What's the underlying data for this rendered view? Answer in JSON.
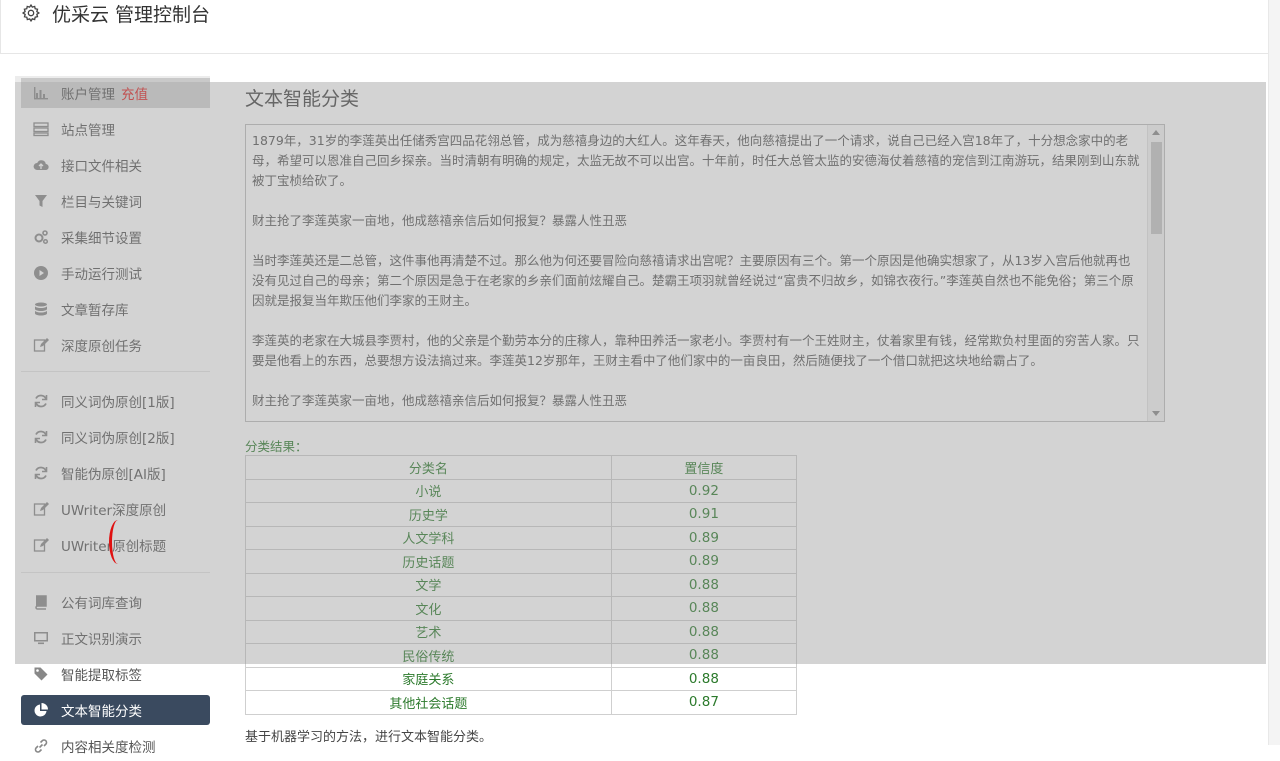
{
  "header": {
    "title": "优采云 管理控制台",
    "icon": "gear-icon"
  },
  "sidebar": {
    "account": {
      "label": "账户管理",
      "recharge": "充值"
    },
    "group1": [
      {
        "label": "站点管理",
        "icon": "server-icon"
      },
      {
        "label": "接口文件相关",
        "icon": "cloud-upload-icon"
      },
      {
        "label": "栏目与关键词",
        "icon": "filter-icon"
      },
      {
        "label": "采集细节设置",
        "icon": "cogs-icon"
      },
      {
        "label": "手动运行测试",
        "icon": "play-circle-icon"
      },
      {
        "label": "文章暂存库",
        "icon": "database-icon"
      },
      {
        "label": "深度原创任务",
        "icon": "edit-icon"
      }
    ],
    "group2": [
      {
        "label": "同义词伪原创[1版]",
        "icon": "refresh-icon"
      },
      {
        "label": "同义词伪原创[2版]",
        "icon": "refresh-icon"
      },
      {
        "label": "智能伪原创[AI版]",
        "icon": "refresh-icon"
      },
      {
        "label": "UWriter深度原创",
        "icon": "edit-icon"
      },
      {
        "label": "UWriter原创标题",
        "icon": "edit-icon"
      }
    ],
    "group3": [
      {
        "label": "公有词库查询",
        "icon": "book-icon"
      },
      {
        "label": "正文识别演示",
        "icon": "monitor-icon"
      },
      {
        "label": "智能提取标签",
        "icon": "tag-icon"
      },
      {
        "label": "文本智能分类",
        "icon": "pie-chart-icon"
      },
      {
        "label": "内容相关度检测",
        "icon": "link-icon"
      }
    ]
  },
  "main": {
    "title": "文本智能分类",
    "text_content": "1879年，31岁的李莲英出任储秀宫四品花翎总管，成为慈禧身边的大红人。这年春天，他向慈禧提出了一个请求，说自己已经入宫18年了，十分想念家中的老母，希望可以恩准自己回乡探亲。当时清朝有明确的规定，太监无故不可以出宫。十年前，时任大总管太监的安德海仗着慈禧的宠信到江南游玩，结果刚到山东就被丁宝桢给砍了。\n\n财主抢了李莲英家一亩地，他成慈禧亲信后如何报复？暴露人性丑恶\n\n当时李莲英还是二总管，这件事他再清楚不过。那么他为何还要冒险向慈禧请求出宫呢？主要原因有三个。第一个原因是他确实想家了，从13岁入宫后他就再也没有见过自己的母亲；第二个原因是急于在老家的乡亲们面前炫耀自己。楚霸王项羽就曾经说过“富贵不归故乡，如锦衣夜行。”李莲英自然也不能免俗；第三个原因就是报复当年欺压他们李家的王财主。\n\n李莲英的老家在大城县李贾村，他的父亲是个勤劳本分的庄稼人，靠种田养活一家老小。李贾村有一个王姓财主，仗着家里有钱，经常欺负村里面的穷苦人家。只要是他看上的东西，总要想方设法搞过来。李莲英12岁那年，王财主看中了他们家中的一亩良田，然后随便找了一个借口就把这块地给霸占了。\n\n财主抢了李莲英家一亩地，他成慈禧亲信后如何报复？暴露人性丑恶",
    "result_label": "分类结果：",
    "table": {
      "headers": [
        "分类名",
        "置信度"
      ],
      "rows": [
        [
          "小说",
          "0.92"
        ],
        [
          "历史学",
          "0.91"
        ],
        [
          "人文学科",
          "0.89"
        ],
        [
          "历史话题",
          "0.89"
        ],
        [
          "文学",
          "0.88"
        ],
        [
          "文化",
          "0.88"
        ],
        [
          "艺术",
          "0.88"
        ],
        [
          "民俗传统",
          "0.88"
        ],
        [
          "家庭关系",
          "0.88"
        ],
        [
          "其他社会话题",
          "0.87"
        ]
      ]
    },
    "footer_note": "基于机器学习的方法，进行文本智能分类。"
  },
  "colors": {
    "accent_green": "#2c7a2c",
    "active_nav": "#3a4a5f",
    "recharge_red": "#e02020"
  }
}
